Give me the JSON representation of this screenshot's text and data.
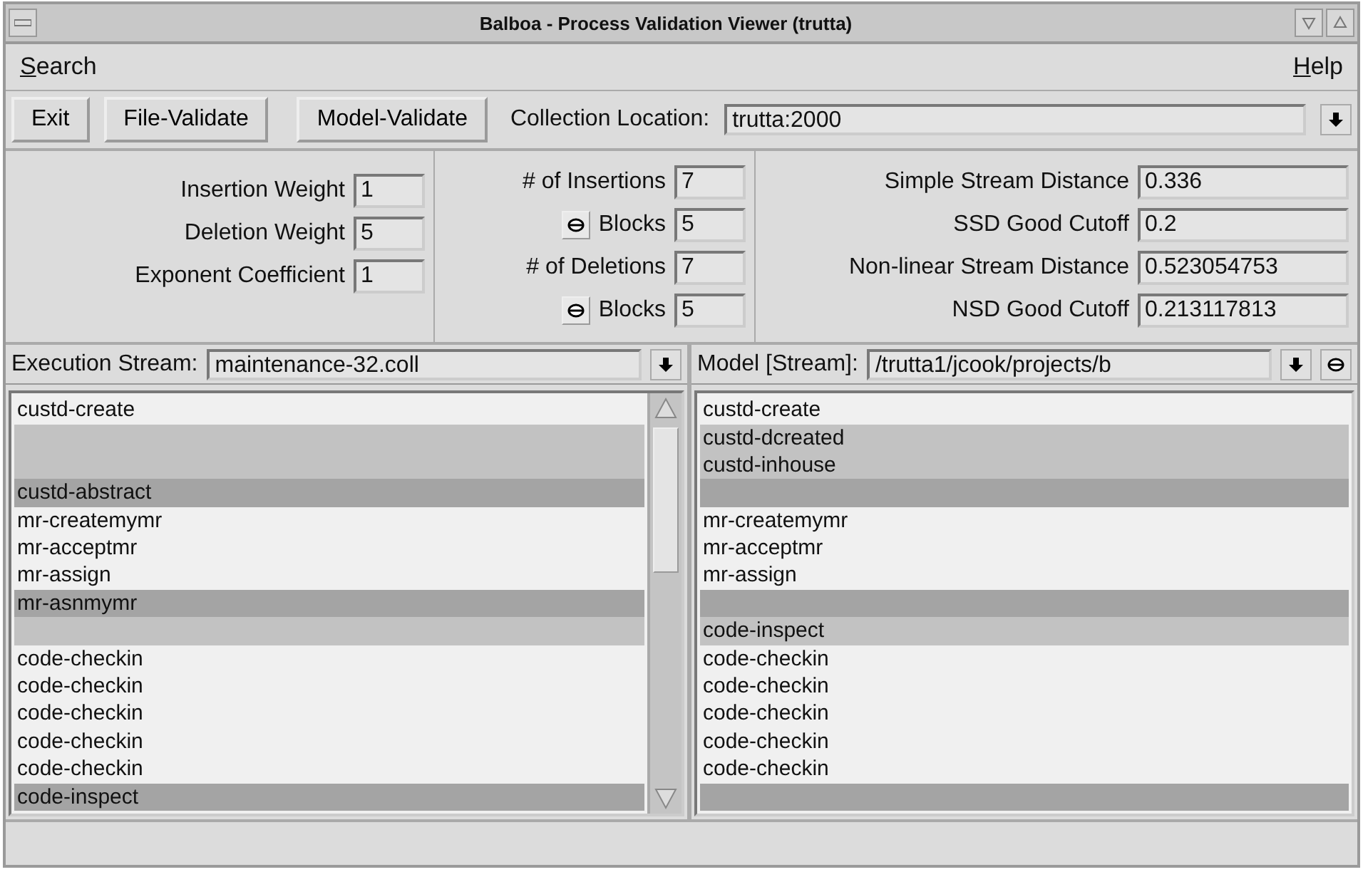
{
  "window": {
    "title": "Balboa - Process Validation Viewer (trutta)"
  },
  "menu": [
    {
      "label": "Search"
    },
    {
      "label": "Help"
    }
  ],
  "toolbar": {
    "buttons": [
      "Exit",
      "File-Validate",
      "Model-Validate"
    ],
    "collection_location": {
      "label": "Collection Location:",
      "value": "trutta:2000"
    }
  },
  "weights": [
    {
      "label": "Insertion Weight",
      "value": "1"
    },
    {
      "label": "Deletion Weight",
      "value": "5"
    },
    {
      "label": "Exponent Coefficient",
      "value": "1"
    }
  ],
  "counts": [
    {
      "kind": "plain",
      "label": "# of Insertions",
      "value": "7"
    },
    {
      "kind": "toggle",
      "label": "Blocks",
      "value": "5"
    },
    {
      "kind": "plain",
      "label": "# of Deletions",
      "value": "7"
    },
    {
      "kind": "toggle",
      "label": "Blocks",
      "value": "5"
    }
  ],
  "distances": [
    {
      "label": "Simple Stream Distance",
      "value": "0.336"
    },
    {
      "label": "SSD Good Cutoff",
      "value": "0.2"
    },
    {
      "label": "Non-linear Stream Distance",
      "value": "0.523054753"
    },
    {
      "label": "NSD Good Cutoff",
      "value": "0.213117813"
    }
  ],
  "execution_stream": {
    "label": "Execution Stream:",
    "value": "maintenance-32.coll",
    "rows": [
      {
        "text": "custd-create",
        "kind": "plain"
      },
      {
        "kind": "light"
      },
      {
        "kind": "light"
      },
      {
        "text": "custd-abstract",
        "kind": "dark"
      },
      {
        "text": "mr-createmymr",
        "kind": "plain"
      },
      {
        "text": "mr-acceptmr",
        "kind": "plain"
      },
      {
        "text": "mr-assign",
        "kind": "plain"
      },
      {
        "text": "mr-asnmymr",
        "kind": "dark"
      },
      {
        "kind": "light"
      },
      {
        "text": "code-checkin",
        "kind": "plain"
      },
      {
        "text": "code-checkin",
        "kind": "plain"
      },
      {
        "text": "code-checkin",
        "kind": "plain"
      },
      {
        "text": "code-checkin",
        "kind": "plain"
      },
      {
        "text": "code-checkin",
        "kind": "plain"
      },
      {
        "text": "code-inspect",
        "kind": "dark"
      }
    ]
  },
  "model_stream": {
    "label": "Model [Stream]:",
    "value": "/trutta1/jcook/projects/b",
    "rows": [
      {
        "text": "custd-create",
        "kind": "plain"
      },
      {
        "text": "custd-dcreated",
        "kind": "light"
      },
      {
        "text": "custd-inhouse",
        "kind": "light"
      },
      {
        "kind": "dark"
      },
      {
        "text": "mr-createmymr",
        "kind": "plain"
      },
      {
        "text": "mr-acceptmr",
        "kind": "plain"
      },
      {
        "text": "mr-assign",
        "kind": "plain"
      },
      {
        "kind": "dark"
      },
      {
        "text": "code-inspect",
        "kind": "light"
      },
      {
        "text": "code-checkin",
        "kind": "plain"
      },
      {
        "text": "code-checkin",
        "kind": "plain"
      },
      {
        "text": "code-checkin",
        "kind": "plain"
      },
      {
        "text": "code-checkin",
        "kind": "plain"
      },
      {
        "text": "code-checkin",
        "kind": "plain"
      },
      {
        "kind": "dark"
      }
    ]
  }
}
